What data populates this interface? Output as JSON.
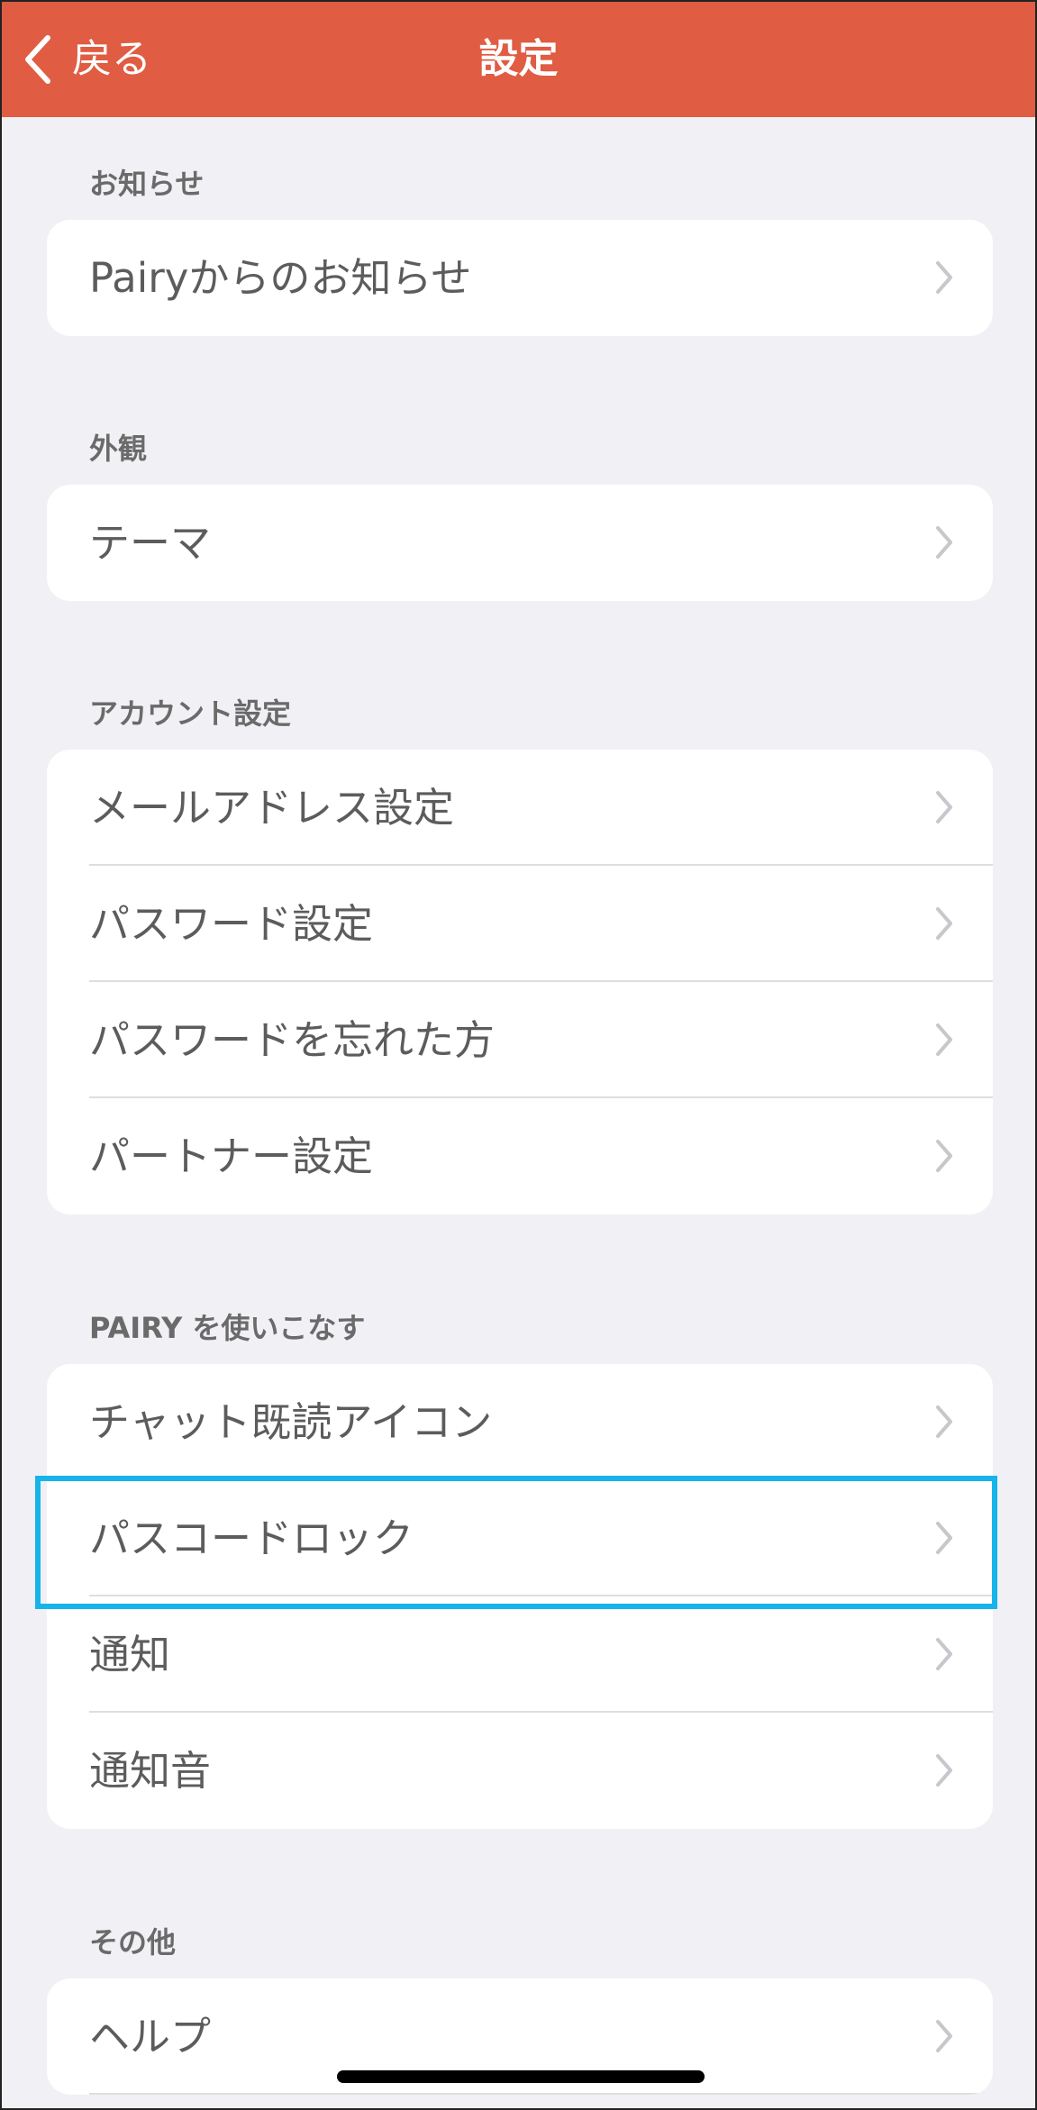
{
  "navbar": {
    "back_label": "戻る",
    "title": "設定",
    "background_color": "#e05c42",
    "back_icon": "chevron-left-icon"
  },
  "sections": [
    {
      "header": "お知らせ",
      "items": [
        {
          "label": "Pairyからのお知らせ"
        }
      ]
    },
    {
      "header": "外観",
      "items": [
        {
          "label": "テーマ"
        }
      ]
    },
    {
      "header": "アカウント設定",
      "items": [
        {
          "label": "メールアドレス設定"
        },
        {
          "label": "パスワード設定"
        },
        {
          "label": "パスワードを忘れた方"
        },
        {
          "label": "パートナー設定"
        }
      ]
    },
    {
      "header": "PAIRY を使いこなす",
      "items": [
        {
          "label": "チャット既読アイコン"
        },
        {
          "label": "パスコードロック"
        },
        {
          "label": "通知"
        },
        {
          "label": "通知音"
        }
      ]
    },
    {
      "header": "その他",
      "items": [
        {
          "label": "ヘルプ"
        }
      ]
    }
  ],
  "row_icon": "chevron-right-icon",
  "highlighted_item": "パスコードロック",
  "highlight_color": "#16b4ea"
}
